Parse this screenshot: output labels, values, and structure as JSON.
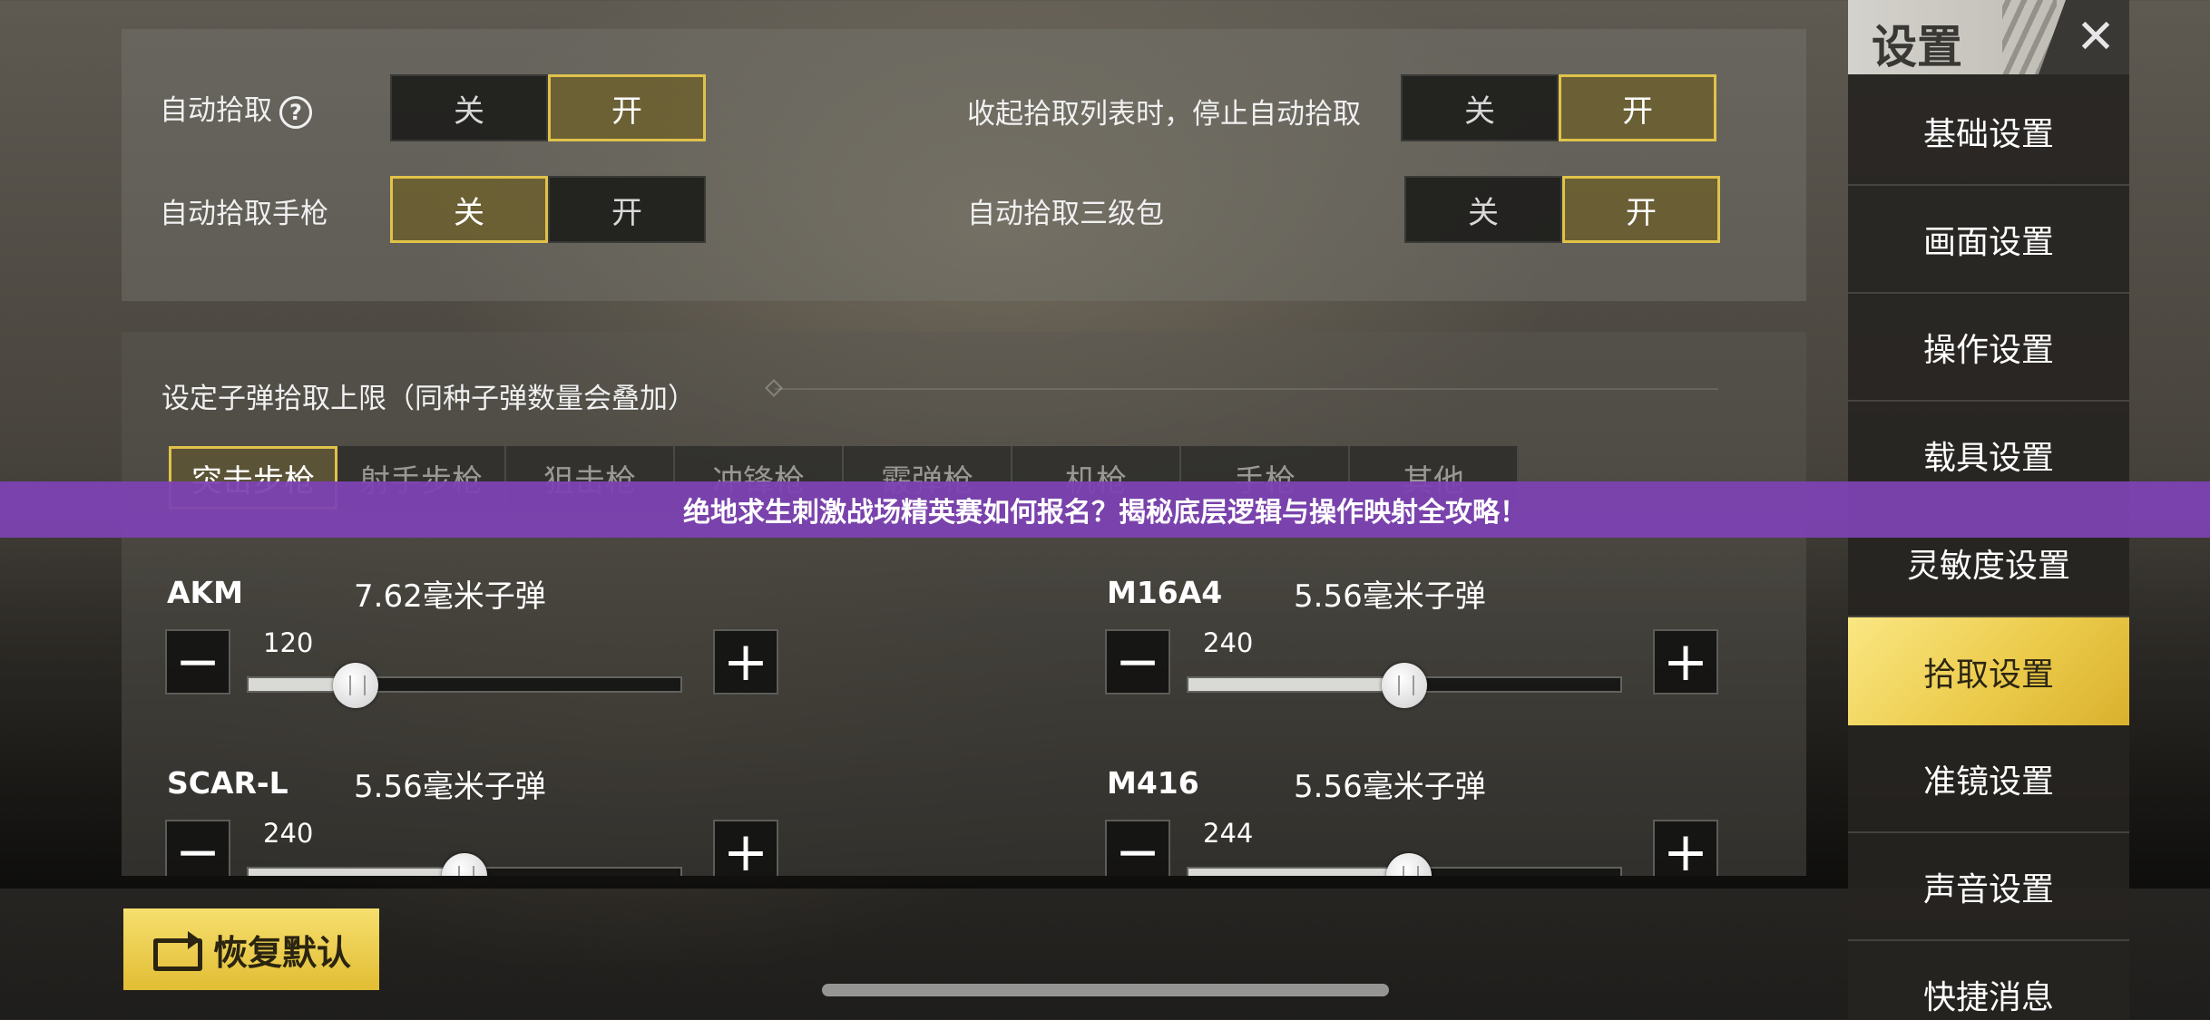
{
  "top_settings": {
    "auto_pickup": {
      "label": "自动拾取",
      "off": "关",
      "on": "开",
      "selected": "on"
    },
    "auto_pickup_pistol": {
      "label": "自动拾取手枪",
      "off": "关",
      "on": "开",
      "selected": "off"
    },
    "stop_on_collapse": {
      "label": "收起拾取列表时，停止自动拾取",
      "off": "关",
      "on": "开",
      "selected": "on"
    },
    "auto_pickup_lv3_bag": {
      "label": "自动拾取三级包",
      "off": "关",
      "on": "开",
      "selected": "on"
    },
    "help_glyph": "?"
  },
  "ammo_section": {
    "title": "设定子弹拾取上限（同种子弹数量会叠加）",
    "tabs": [
      "突击步枪",
      "射手步枪",
      "狙击枪",
      "冲锋枪",
      "霰弹枪",
      "机枪",
      "手枪",
      "其他"
    ],
    "active_tab": 0,
    "minus": "−",
    "plus": "+",
    "weapons": [
      {
        "name": "AKM",
        "ammo": "7.62毫米子弹",
        "value": "120",
        "fraction": 0.25
      },
      {
        "name": "M16A4",
        "ammo": "5.56毫米子弹",
        "value": "240",
        "fraction": 0.5
      },
      {
        "name": "SCAR-L",
        "ammo": "5.56毫米子弹",
        "value": "240",
        "fraction": 0.5
      },
      {
        "name": "M416",
        "ammo": "5.56毫米子弹",
        "value": "244",
        "fraction": 0.51
      }
    ]
  },
  "reset_button": {
    "label": "恢复默认"
  },
  "sidebar": {
    "title": "设置",
    "close_glyph": "✕",
    "items": [
      "基础设置",
      "画面设置",
      "操作设置",
      "载具设置",
      "灵敏度设置",
      "拾取设置",
      "准镜设置",
      "声音设置",
      "快捷消息"
    ],
    "active_index": 5
  },
  "banner": {
    "text": "绝地求生刺激战场精英赛如何报名？揭秘底层逻辑与操作映射全攻略！"
  },
  "colors": {
    "accent_gold": "#e0c24a",
    "banner_purple": "#7c42b2",
    "active_nav": "#eccb4b"
  }
}
